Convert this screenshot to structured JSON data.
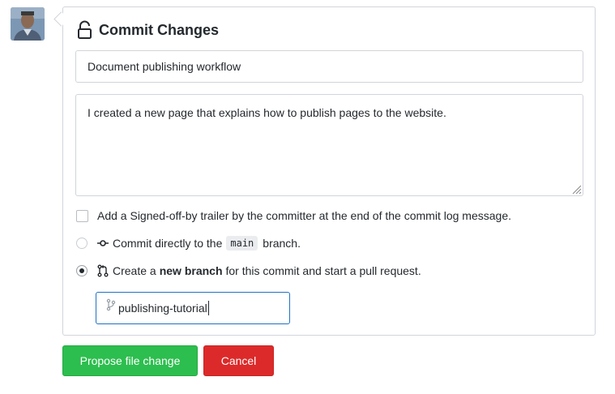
{
  "user": {
    "avatar_icon": "user-avatar"
  },
  "form": {
    "title": "Commit Changes",
    "title_icon": "unlock-icon",
    "summary_value": "Document publishing workflow",
    "description_value": "I created a new page that explains how to publish pages to the website.",
    "signoff_label": "Add a Signed-off-by trailer by the committer at the end of the commit log message.",
    "signoff_checked": false,
    "options": {
      "direct": {
        "checked": false,
        "icon": "git-commit-icon",
        "text_before": "Commit directly to the",
        "branch": "main",
        "text_after": "branch."
      },
      "new_branch": {
        "checked": true,
        "icon": "git-pull-request-icon",
        "text_before": "Create a",
        "emphasis": "new branch",
        "text_after": "for this commit and start a pull request."
      }
    },
    "branch_name_value": "publishing-tutorial",
    "branch_icon": "git-branch-icon"
  },
  "buttons": {
    "propose_label": "Propose file change",
    "cancel_label": "Cancel"
  },
  "colors": {
    "primary": "#2cbe4e",
    "danger": "#dc2a2a",
    "focus": "#1f72c4",
    "border": "#d1d5da"
  }
}
